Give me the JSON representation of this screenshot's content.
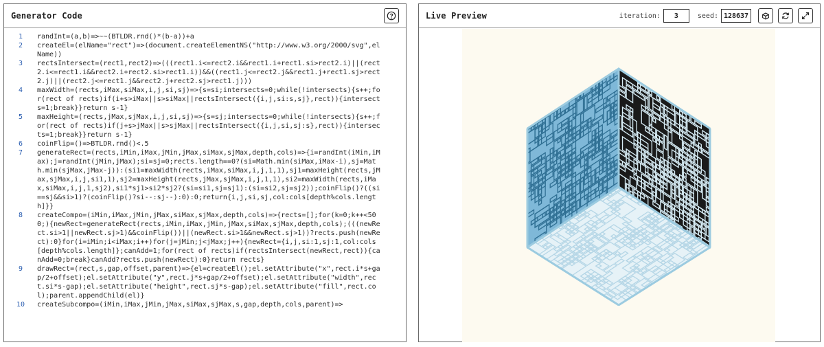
{
  "left_panel": {
    "title": "Generator Code",
    "help_icon": "help-circle-icon"
  },
  "right_panel": {
    "title": "Live Preview",
    "iteration_label": "iteration:",
    "iteration_value": "3",
    "seed_label": "seed:",
    "seed_value": "128637",
    "buttons": [
      "dice-icon",
      "refresh-icon",
      "expand-icon"
    ]
  },
  "code_lines": [
    {
      "n": "1",
      "text": "randInt=(a,b)=>~~(BTLDR.rnd()*(b-a))+a"
    },
    {
      "n": "2",
      "text": "createEl=(elName=\"rect\")=>(document.createElementNS(\"http://www.w3.org/2000/svg\",elName))"
    },
    {
      "n": "3",
      "text": "rectsIntersect=(rect1,rect2)=>(((rect1.i<=rect2.i&&rect1.i+rect1.si>rect2.i)||(rect2.i<=rect1.i&&rect2.i+rect2.si>rect1.i))&&((rect1.j<=rect2.j&&rect1.j+rect1.sj>rect2.j)||(rect2.j<=rect1.j&&rect2.j+rect2.sj>rect1.j)))"
    },
    {
      "n": "4",
      "text": "maxWidth=(rects,iMax,siMax,i,j,si,sj)=>{s=si;intersects=0;while(!intersects){s++;for(rect of rects)if(i+s>iMax||s>siMax||rectsIntersect({i,j,si:s,sj},rect)){intersects=1;break}}return s-1}"
    },
    {
      "n": "5",
      "text": "maxHeight=(rects,jMax,sjMax,i,j,si,sj)=>{s=sj;intersects=0;while(!intersects){s++;for(rect of rects)if(j+s>jMax||s>sjMax||rectsIntersect({i,j,si,sj:s},rect)){intersects=1;break}}return s-1}"
    },
    {
      "n": "6",
      "text": "coinFlip=()=>BTLDR.rnd()<.5"
    },
    {
      "n": "7",
      "text": "generateRect=(rects,iMin,iMax,jMin,jMax,siMax,sjMax,depth,cols)=>{i=randInt(iMin,iMax);j=randInt(jMin,jMax);si=sj=0;rects.length==0?(si=Math.min(siMax,iMax-i),sj=Math.min(sjMax,jMax-j)):(si1=maxWidth(rects,iMax,siMax,i,j,1,1),sj1=maxHeight(rects,jMax,sjMax,i,j,si1,1),sj2=maxHeight(rects,jMax,sjMax,i,j,1,1),si2=maxWidth(rects,iMax,siMax,i,j,1,sj2),si1*sj1>si2*sj2?(si=si1,sj=sj1):(si=si2,sj=sj2));coinFlip()?((si==sj&&si>1)?(coinFlip()?si--:sj--):0):0;return{i,j,si,sj,col:cols[depth%cols.length]}}"
    },
    {
      "n": "8",
      "text": "createCompo=(iMin,iMax,jMin,jMax,siMax,sjMax,depth,cols)=>{rects=[];for(k=0;k++<500;){newRect=generateRect(rects,iMin,iMax,jMin,jMax,siMax,sjMax,depth,cols);(((newRect.si>1||newRect.sj>1)&&coinFlip())||(newRect.si>1&&newRect.sj>1))?rects.push(newRect):0}for(i=iMin;i<iMax;i++)for(j=jMin;j<jMax;j++){newRect={i,j,si:1,sj:1,col:cols[depth%cols.length]};canAdd=1;for(rect of rects)if(rectsIntersect(newRect,rect)){canAdd=0;break}canAdd?rects.push(newRect):0}return rects}"
    },
    {
      "n": "9",
      "text": "drawRect=(rect,s,gap,offset,parent)=>{el=createEl();el.setAttribute(\"x\",rect.i*s+gap/2+offset);el.setAttribute(\"y\",rect.j*s+gap/2+offset);el.setAttribute(\"width\",rect.si*s-gap);el.setAttribute(\"height\",rect.sj*s-gap);el.setAttribute(\"fill\",rect.col);parent.appendChild(el)}"
    },
    {
      "n": "10",
      "text": "createSubcompo=(iMin,iMax,jMin,jMax,siMax,sjMax,s,gap,depth,cols,parent)=>"
    }
  ],
  "colors": {
    "left_face": "#7fb8d8",
    "right_face": "#1a1a1a",
    "top_face": "#e6f2f7",
    "edge": "#9ccbe0",
    "maze_light": "#d7ecf5"
  }
}
